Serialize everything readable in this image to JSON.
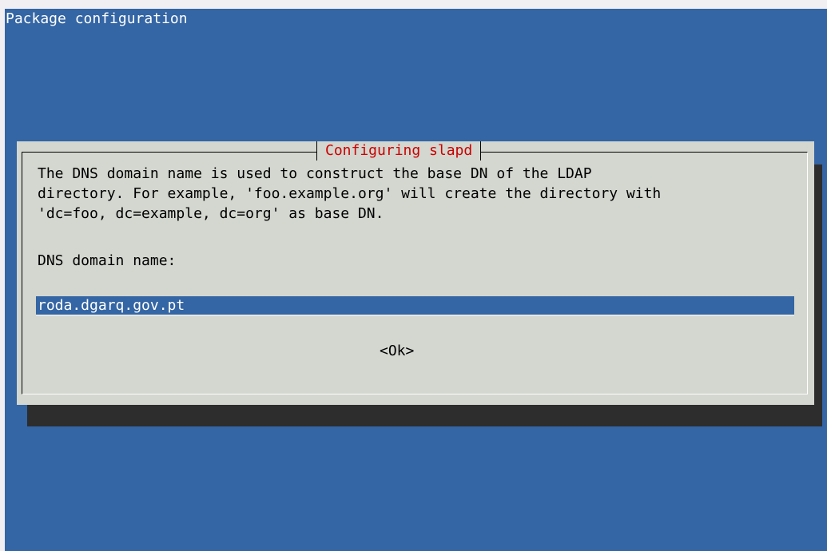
{
  "backtitle": "Package configuration",
  "dialog": {
    "title": "Configuring slapd",
    "prompt_lines": [
      "The DNS domain name is used to construct the base DN of the LDAP",
      "directory. For example, 'foo.example.org' will create the directory with",
      "'dc=foo, dc=example, dc=org' as base DN."
    ],
    "field_label": "DNS domain name:",
    "field_value": "roda.dgarq.gov.pt",
    "ok_label": "<Ok>"
  },
  "colors": {
    "background": "#3465a4",
    "dialog": "#d3d7cf",
    "title": "#cc0000",
    "shadow": "#2d2d2d"
  }
}
